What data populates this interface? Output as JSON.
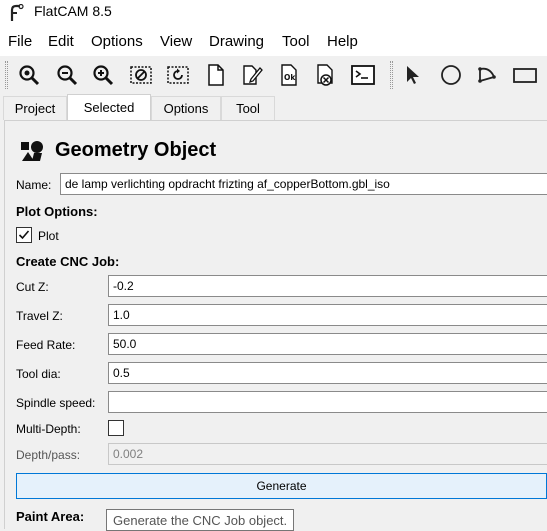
{
  "window": {
    "title": "FlatCAM 8.5"
  },
  "menu": [
    "File",
    "Edit",
    "Options",
    "View",
    "Drawing",
    "Tool",
    "Help"
  ],
  "toolbar": {
    "icons": [
      "zoom-fit-icon",
      "zoom-out-icon",
      "zoom-in-icon",
      "clear-plot-icon",
      "replot-icon",
      "new-project-icon",
      "edit-geometry-icon",
      "update-geometry-icon",
      "delete-icon",
      "shell-icon",
      "select-tool-icon",
      "circle-tool-icon",
      "arc-tool-icon",
      "rectangle-tool-icon"
    ]
  },
  "tabs": [
    {
      "label": "Project",
      "active": false
    },
    {
      "label": "Selected",
      "active": true
    },
    {
      "label": "Options",
      "active": false
    },
    {
      "label": "Tool",
      "active": false
    }
  ],
  "panel": {
    "title": "Geometry Object",
    "name_label": "Name:",
    "name_value": "de lamp verlichting opdracht frizting af_copperBottom.gbl_iso",
    "plot_options_label": "Plot Options:",
    "plot_label": "Plot",
    "plot_checked": true,
    "create_cnc_label": "Create CNC Job:",
    "cut_z_label": "Cut Z:",
    "cut_z_value": "-0.2",
    "travel_z_label": "Travel Z:",
    "travel_z_value": "1.0",
    "feed_rate_label": "Feed Rate:",
    "feed_rate_value": "50.0",
    "tool_dia_label": "Tool dia:",
    "tool_dia_value": "0.5",
    "spindle_speed_label": "Spindle speed:",
    "spindle_speed_value": "",
    "multi_depth_label": "Multi-Depth:",
    "multi_depth_checked": false,
    "depth_pass_label": "Depth/pass:",
    "depth_pass_value": "0.002",
    "generate_label": "Generate",
    "paint_area_label": "Paint Area:",
    "tooltip": "Generate the CNC Job object."
  },
  "colors": {
    "accent": "#0078d7",
    "button_bg": "#e5f1fb",
    "panel_bg": "#f0f0f0"
  }
}
